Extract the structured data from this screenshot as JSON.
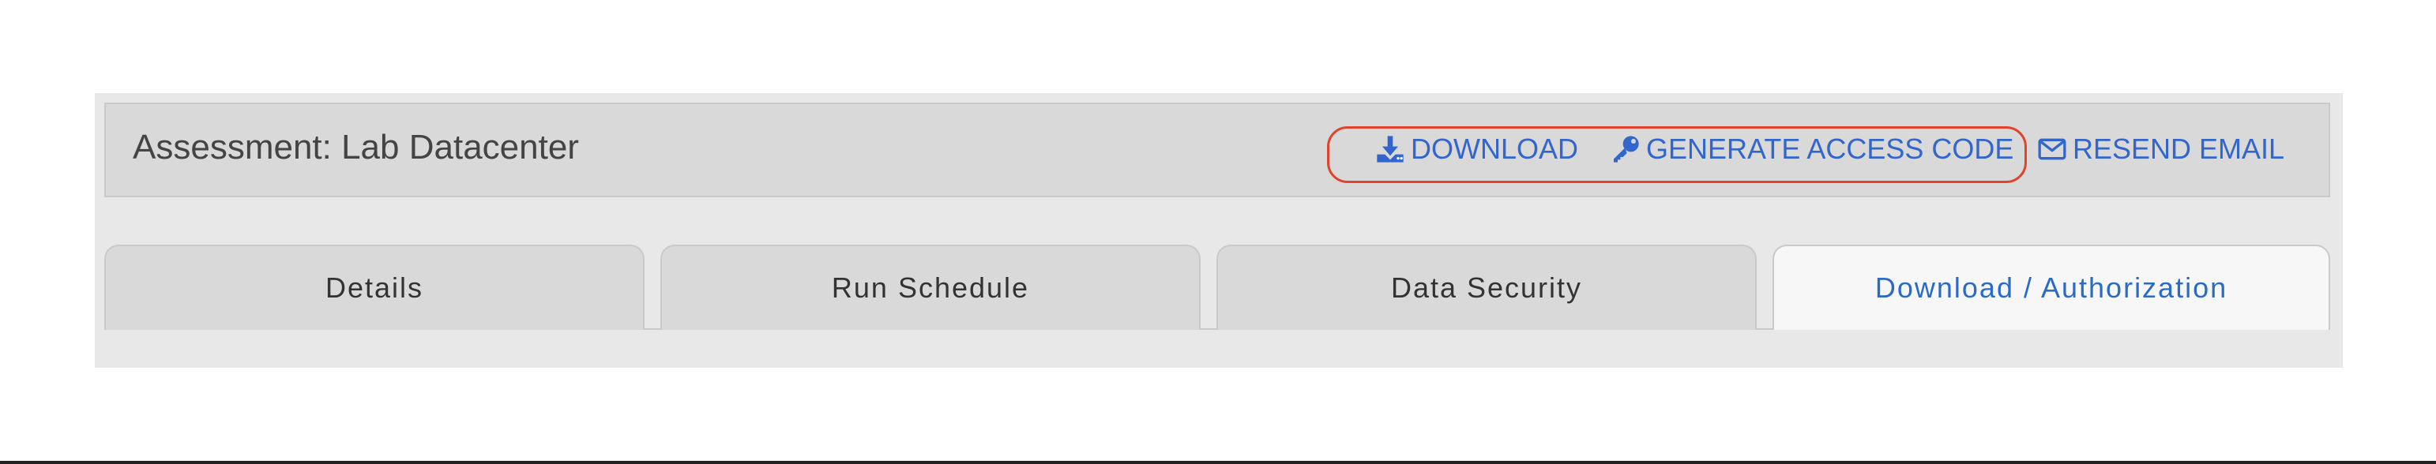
{
  "header": {
    "title": "Assessment: Lab Datacenter",
    "actions": [
      {
        "label": "DOWNLOAD",
        "icon": "download-icon"
      },
      {
        "label": "GENERATE ACCESS CODE",
        "icon": "key-icon"
      },
      {
        "label": "RESEND EMAIL",
        "icon": "envelope-icon"
      }
    ]
  },
  "tabs": [
    {
      "label": "Details",
      "active": false
    },
    {
      "label": "Run Schedule",
      "active": false
    },
    {
      "label": "Data Security",
      "active": false
    },
    {
      "label": "Download / Authorization",
      "active": true
    }
  ],
  "colors": {
    "accent": "#3366cc",
    "highlight": "#e0442c",
    "active_tab_text": "#2a6bc8"
  }
}
